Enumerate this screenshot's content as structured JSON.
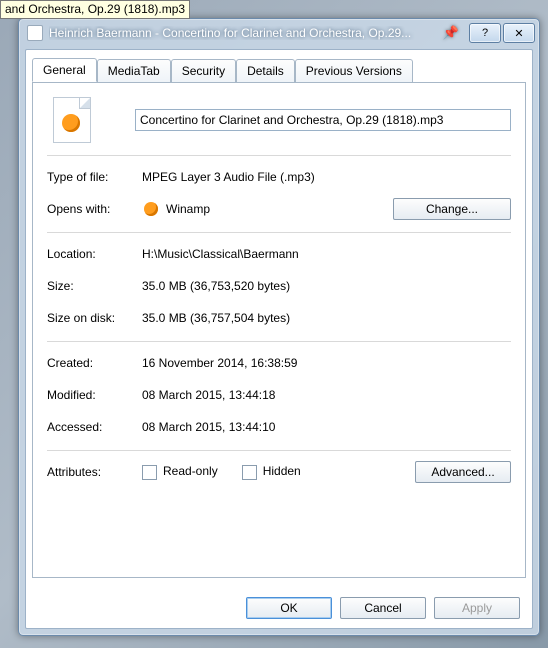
{
  "tooltip": "and Orchestra, Op.29 (1818).mp3",
  "window": {
    "title": "Heinrich Baermann - Concertino for Clarinet and Orchestra, Op.29..."
  },
  "tabs": {
    "general": "General",
    "media": "MediaTab",
    "security": "Security",
    "details": "Details",
    "previous": "Previous Versions"
  },
  "filename_value": "Concertino for Clarinet and Orchestra, Op.29 (1818).mp3",
  "labels": {
    "type": "Type of file:",
    "opens": "Opens with:",
    "location": "Location:",
    "size": "Size:",
    "sizeondisk": "Size on disk:",
    "created": "Created:",
    "modified": "Modified:",
    "accessed": "Accessed:",
    "attributes": "Attributes:",
    "readonly": "Read-only",
    "hidden": "Hidden"
  },
  "values": {
    "type": "MPEG Layer 3 Audio File (.mp3)",
    "opens_app": "Winamp",
    "location": "H:\\Music\\Classical\\Baermann",
    "size": "35.0 MB (36,753,520 bytes)",
    "sizeondisk": "35.0 MB (36,757,504 bytes)",
    "created": "16 November 2014, 16:38:59",
    "modified": "08 March 2015, 13:44:18",
    "accessed": "08 March 2015, 13:44:10"
  },
  "buttons": {
    "change": "Change...",
    "advanced": "Advanced...",
    "ok": "OK",
    "cancel": "Cancel",
    "apply": "Apply"
  }
}
